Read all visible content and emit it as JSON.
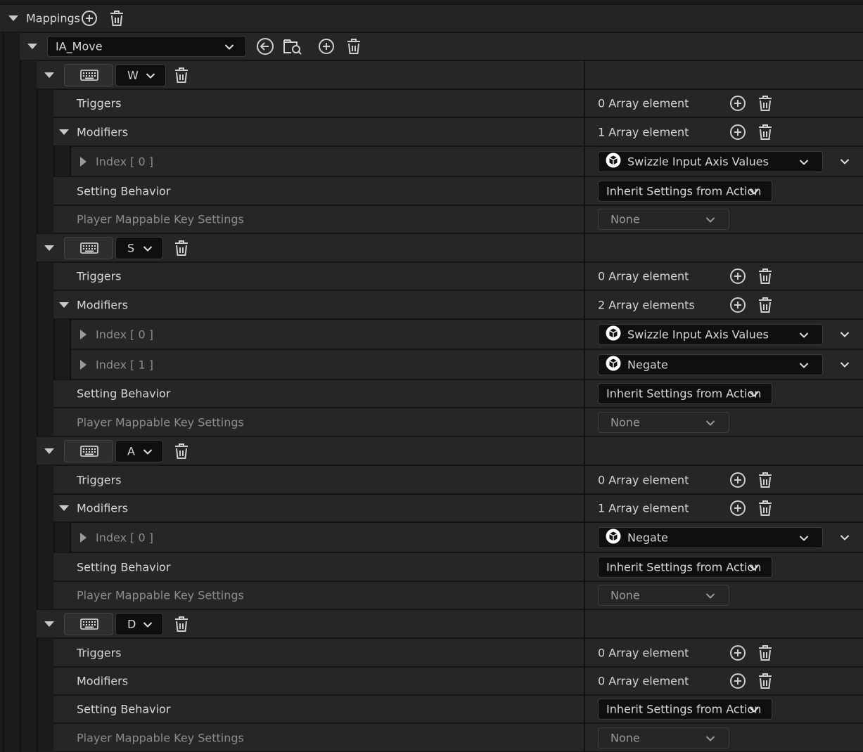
{
  "mappings": {
    "label": "Mappings",
    "action": "IA_Move",
    "keys": [
      {
        "key": "W",
        "triggers": {
          "label": "Triggers",
          "count_text": "0 Array element"
        },
        "modifiers": {
          "label": "Modifiers",
          "count_text": "1 Array element",
          "items": [
            {
              "index_label": "Index [ 0 ]",
              "value": "Swizzle Input Axis Values"
            }
          ]
        },
        "setting_behavior": {
          "label": "Setting Behavior",
          "value": "Inherit Settings from Action"
        },
        "player_mappable": {
          "label": "Player Mappable Key Settings",
          "value": "None"
        }
      },
      {
        "key": "S",
        "triggers": {
          "label": "Triggers",
          "count_text": "0 Array element"
        },
        "modifiers": {
          "label": "Modifiers",
          "count_text": "2 Array elements",
          "items": [
            {
              "index_label": "Index [ 0 ]",
              "value": "Swizzle Input Axis Values"
            },
            {
              "index_label": "Index [ 1 ]",
              "value": "Negate"
            }
          ]
        },
        "setting_behavior": {
          "label": "Setting Behavior",
          "value": "Inherit Settings from Action"
        },
        "player_mappable": {
          "label": "Player Mappable Key Settings",
          "value": "None"
        }
      },
      {
        "key": "A",
        "triggers": {
          "label": "Triggers",
          "count_text": "0 Array element"
        },
        "modifiers": {
          "label": "Modifiers",
          "count_text": "1 Array element",
          "items": [
            {
              "index_label": "Index [ 0 ]",
              "value": "Negate"
            }
          ]
        },
        "setting_behavior": {
          "label": "Setting Behavior",
          "value": "Inherit Settings from Action"
        },
        "player_mappable": {
          "label": "Player Mappable Key Settings",
          "value": "None"
        }
      },
      {
        "key": "D",
        "triggers": {
          "label": "Triggers",
          "count_text": "0 Array element"
        },
        "modifiers": {
          "label": "Modifiers",
          "count_text": "0 Array element",
          "items": []
        },
        "setting_behavior": {
          "label": "Setting Behavior",
          "value": "Inherit Settings from Action"
        },
        "player_mappable": {
          "label": "Player Mappable Key Settings",
          "value": "None"
        }
      }
    ]
  },
  "icons": {
    "add": "plus-circle-icon",
    "remove": "trash-icon",
    "browse": "arrow-left-circle-icon",
    "find": "folder-search-icon",
    "keyboard": "keyboard-icon",
    "modifier": "cube-icon",
    "dropdown": "chevron-down-icon"
  },
  "colors": {
    "background": "#1b1b1b",
    "row": "#262626",
    "field": "#0f0f0f",
    "text": "#d8d8d8",
    "dim_text": "#8c8c8c"
  }
}
